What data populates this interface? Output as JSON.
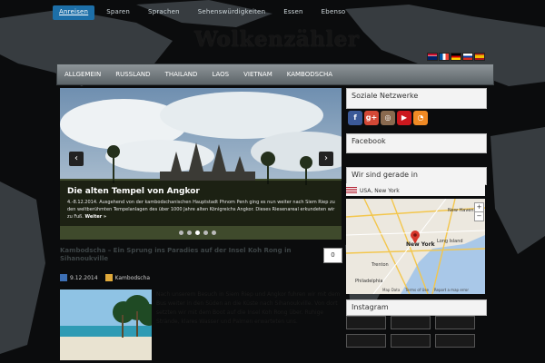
{
  "top_nav": {
    "items": [
      "Anreisen",
      "Sparen",
      "Sprachen",
      "Sehenswürdigkeiten",
      "Essen",
      "Ebenso"
    ]
  },
  "site": {
    "logo": "Wolkenzähler"
  },
  "languages": [
    "en",
    "fr",
    "de",
    "ru",
    "es"
  ],
  "main_nav": {
    "items": [
      "ALLGEMEIN",
      "RUSSLAND",
      "THAILAND",
      "LAOS",
      "VIETNAM",
      "KAMBODSCHA"
    ]
  },
  "slider": {
    "title": "Die alten Tempel von Angkor",
    "text": "4.-8.12.2014. Ausgehend von der kambodschanischen Hauptstadt Phnom Penh ging es nun weiter nach Siem Riep zu den weltberühmten Tempelanlagen des über 1000 Jahre alten Königreichs Angkor. Dieses Riesenareal erkundeten wir zu Fuß.",
    "more": "Weiter »",
    "prev": "‹",
    "next": "›",
    "slide_count": 5,
    "active_slide": 2
  },
  "post": {
    "title": "Kambodscha – Ein Sprung ins Paradies auf der Insel Koh Rong in Sihanoukville",
    "comments": "0",
    "meta": {
      "date": "9.12.2014",
      "category": "Kambodscha"
    },
    "excerpt": "Nach unserem Besuch in Siem Riep und Angkor fuhren wir mit dem Bus weiter in den Süden an die Küste nach Sihanoukville. Von dort setzten wir mit dem Boot auf die Insel Koh Rong über. Ruhige Strände, klares Wasser und Palmen erwarteten uns."
  },
  "sidebar": {
    "social": {
      "title": "Soziale Netzwerke",
      "icons": [
        {
          "name": "facebook-icon",
          "glyph": "f",
          "color": "#3b5998"
        },
        {
          "name": "googleplus-icon",
          "glyph": "g+",
          "color": "#d34836"
        },
        {
          "name": "instagram-icon",
          "glyph": "◎",
          "color": "#8a6a4f"
        },
        {
          "name": "youtube-icon",
          "glyph": "▶",
          "color": "#cc181e"
        },
        {
          "name": "rss-icon",
          "glyph": "◔",
          "color": "#f08a24"
        }
      ]
    },
    "facebook": {
      "title": "Facebook"
    },
    "location": {
      "title": "Wir sind gerade in",
      "place": "USA, New York"
    },
    "map": {
      "city": "New York",
      "nearby": [
        "New Haven",
        "Long Island",
        "Philadelphia",
        "Trenton"
      ],
      "footer": [
        "Map Data",
        "Terms of Use",
        "Report a map error"
      ],
      "zoom": [
        "+",
        "−"
      ]
    },
    "instagram": {
      "title": "Instagram"
    }
  },
  "colors": {
    "accent": "#1d6fa8",
    "nav": "#6f777b",
    "widget_bg": "#f3f3f3"
  }
}
